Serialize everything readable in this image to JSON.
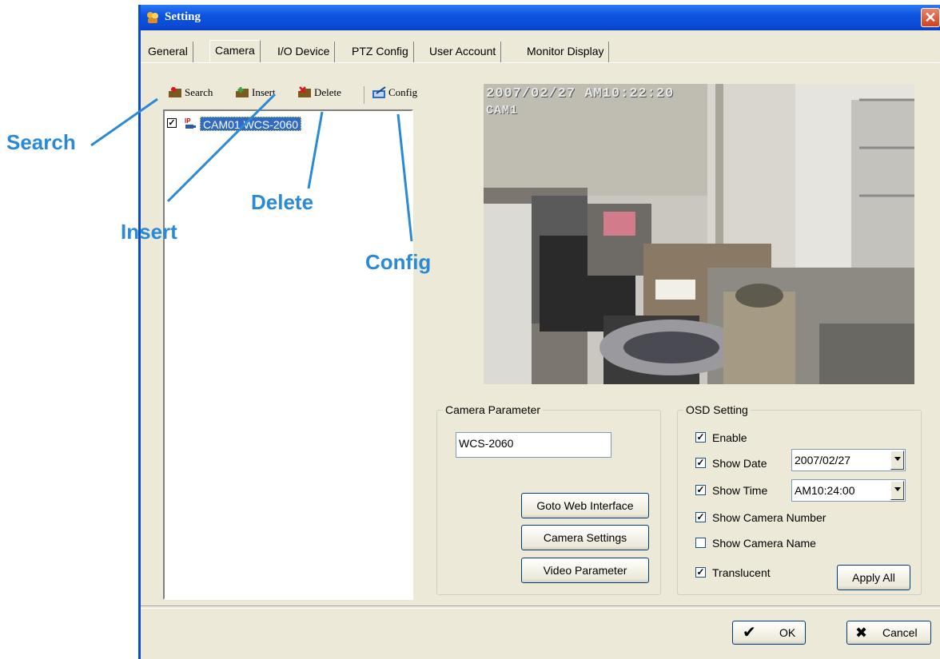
{
  "window": {
    "title": "Setting",
    "close_glyph": "✕"
  },
  "tabs": [
    "General",
    "Camera",
    "I/O Device",
    "PTZ Config",
    "User Account",
    "Monitor Display"
  ],
  "active_tab": "Camera",
  "toolbar": {
    "search": "Search",
    "insert": "Insert",
    "delete": "Delete",
    "config": "Config"
  },
  "tree": {
    "item": {
      "label": "CAM01 WCS-2060",
      "checked": true,
      "check_glyph": "✓",
      "icon": "ip-camera-icon"
    }
  },
  "preview": {
    "date_time": "2007/02/27  AM10:22:20",
    "camera": "CAM1"
  },
  "camera_parameter": {
    "legend": "Camera Parameter",
    "name_value": "WCS-2060",
    "goto_web": "Goto Web Interface",
    "camera_settings": "Camera Settings",
    "video_parameter": "Video Parameter"
  },
  "osd": {
    "legend": "OSD Setting",
    "enable": {
      "label": "Enable",
      "checked": true
    },
    "show_date": {
      "label": "Show Date",
      "checked": true,
      "value": "2007/02/27"
    },
    "show_time": {
      "label": "Show Time",
      "checked": true,
      "value": "AM10:24:00"
    },
    "show_camera_number": {
      "label": "Show Camera Number",
      "checked": true
    },
    "show_camera_name": {
      "label": "Show Camera Name",
      "checked": false
    },
    "translucent": {
      "label": "Translucent",
      "checked": true
    },
    "check_glyph": "✓",
    "apply_all": "Apply All"
  },
  "footer": {
    "ok": "OK",
    "cancel": "Cancel",
    "ok_glyph": "✔",
    "cancel_glyph": "✖"
  },
  "annotations": {
    "search": "Search",
    "insert": "Insert",
    "delete": "Delete",
    "config": "Config"
  },
  "colors": {
    "titlebar": "#0a4ad6",
    "selection": "#316ac5",
    "annotation": "#2a8ad6",
    "dialog_bg": "#ece9d8"
  }
}
